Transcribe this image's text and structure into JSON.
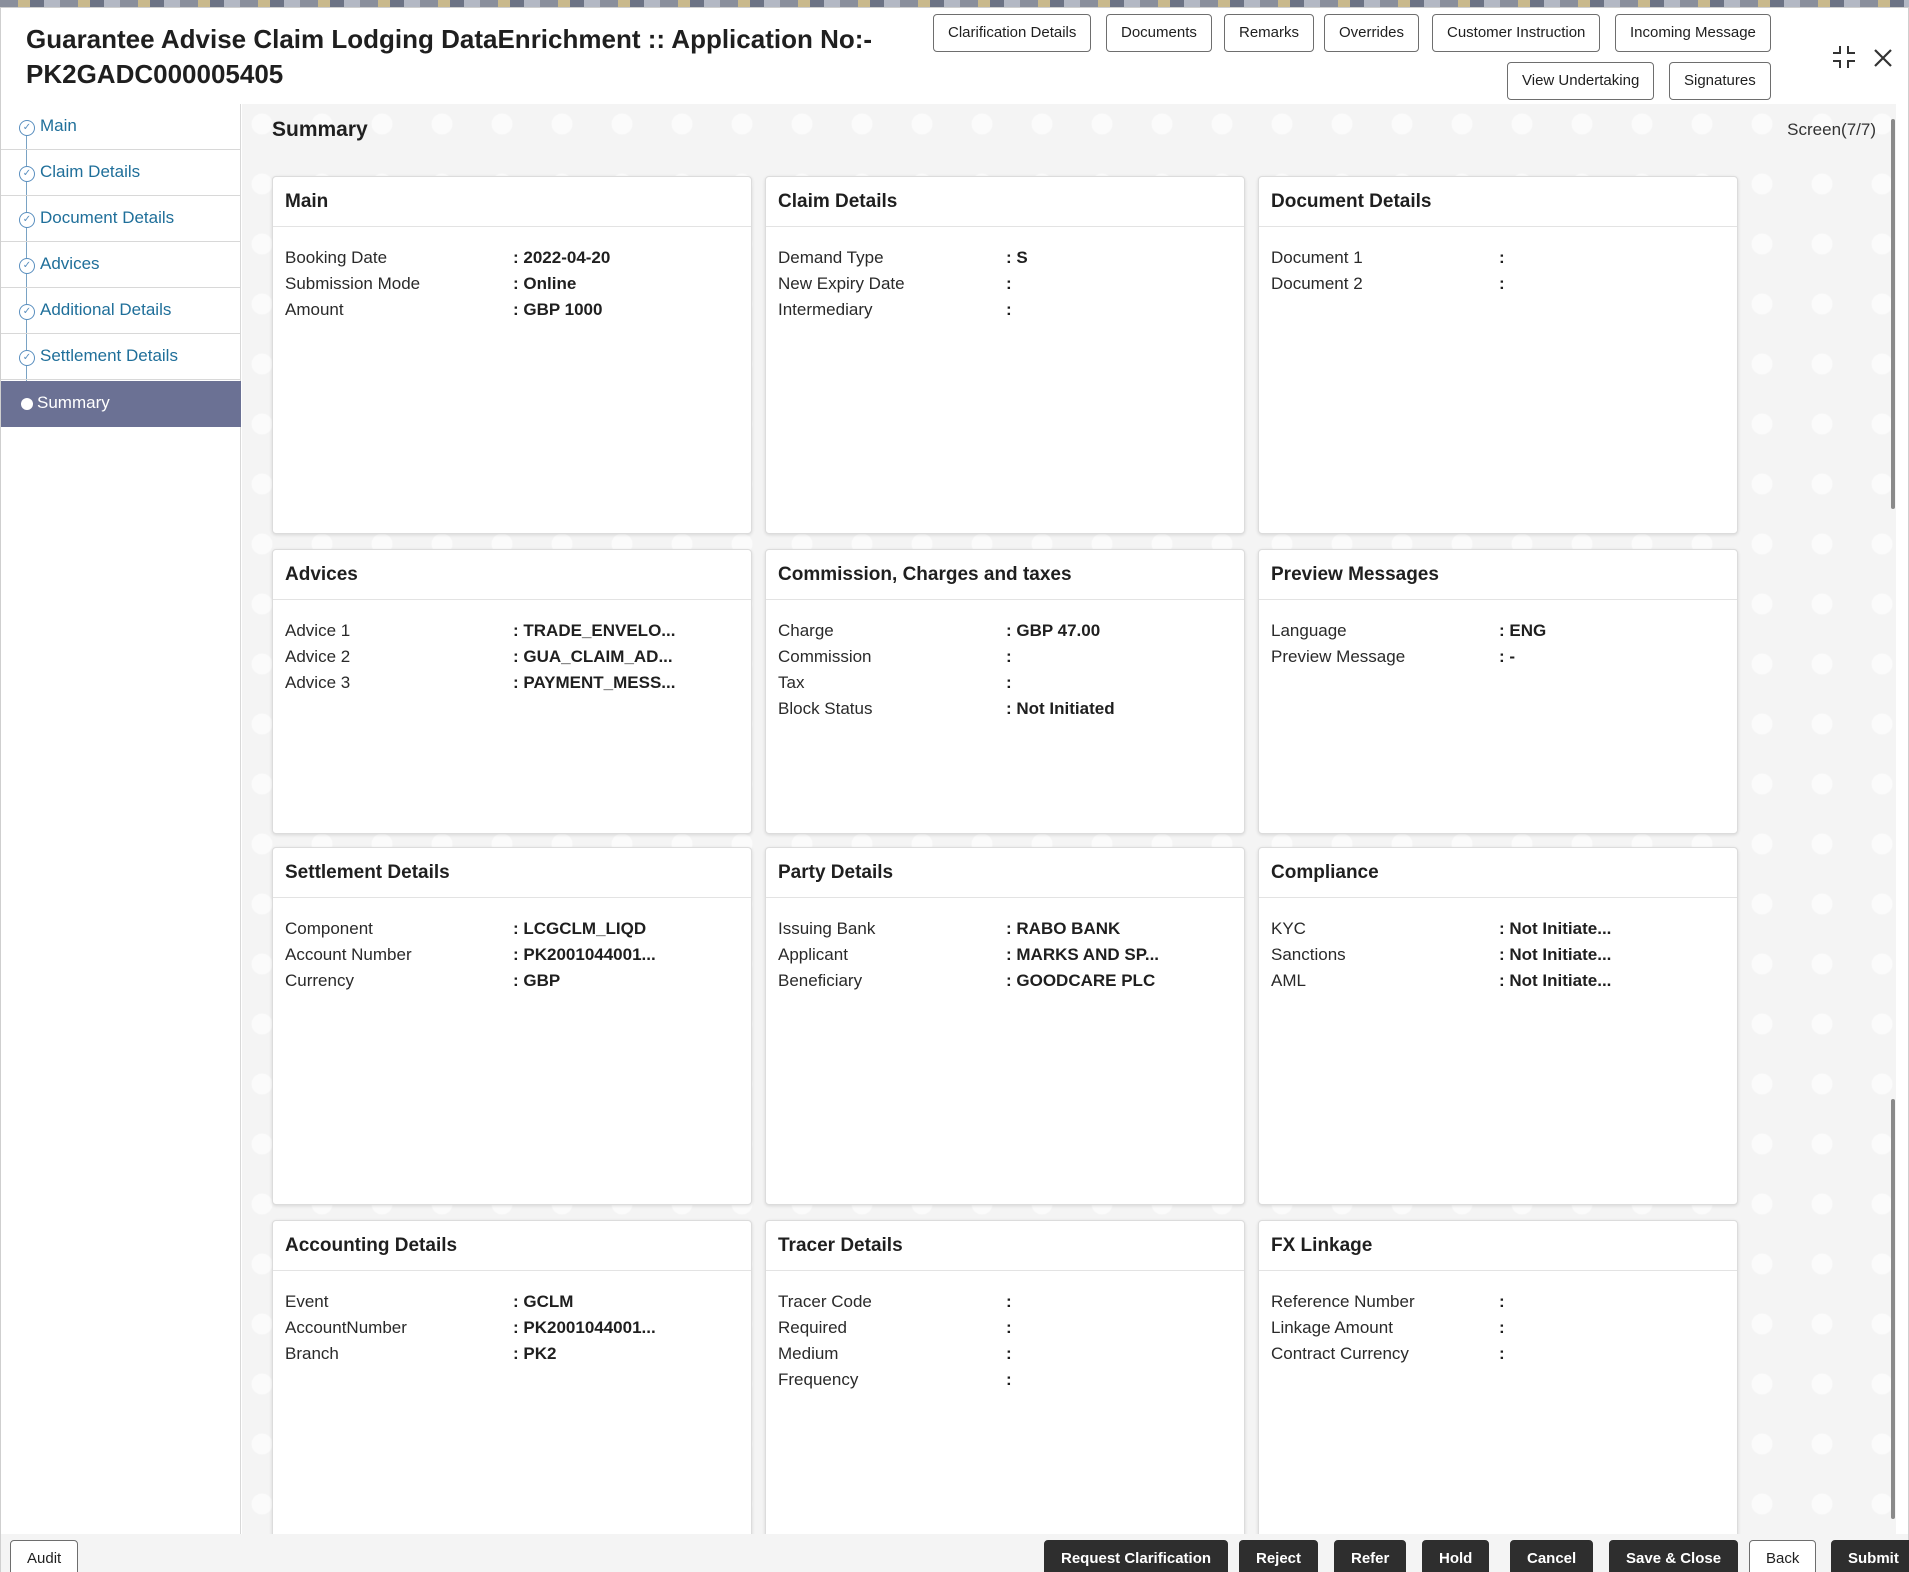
{
  "header": {
    "title_line1": "Guarantee Advise Claim Lodging DataEnrichment :: Application No:-",
    "title_line2": "PK2GADC000005405",
    "buttons": {
      "clarification": "Clarification Details",
      "documents": "Documents",
      "remarks": "Remarks",
      "overrides": "Overrides",
      "customer_instruction": "Customer Instruction",
      "incoming_message": "Incoming Message",
      "view_undertaking": "View Undertaking",
      "signatures": "Signatures"
    },
    "icons": {
      "collapse": "collapse-icon",
      "close": "close-icon"
    }
  },
  "sidebar": {
    "items": [
      {
        "label": "Main"
      },
      {
        "label": "Claim Details"
      },
      {
        "label": "Document Details"
      },
      {
        "label": "Advices"
      },
      {
        "label": "Additional Details"
      },
      {
        "label": "Settlement Details"
      },
      {
        "label": "Summary"
      }
    ]
  },
  "main": {
    "title": "Summary",
    "screen_indicator": "Screen(7/7)",
    "cards": {
      "main": {
        "title": "Main",
        "rows": [
          {
            "label": "Booking Date",
            "value": ": 2022-04-20"
          },
          {
            "label": "Submission Mode",
            "value": ": Online"
          },
          {
            "label": "Amount",
            "value": ": GBP 1000"
          }
        ]
      },
      "claim": {
        "title": "Claim Details",
        "rows": [
          {
            "label": "Demand Type",
            "value": ": S"
          },
          {
            "label": "New Expiry Date",
            "value": ":"
          },
          {
            "label": "Intermediary",
            "value": ":"
          }
        ]
      },
      "document": {
        "title": "Document Details",
        "rows": [
          {
            "label": "Document 1",
            "value": ":"
          },
          {
            "label": "Document 2",
            "value": ":"
          }
        ]
      },
      "advices": {
        "title": "Advices",
        "rows": [
          {
            "label": "Advice 1",
            "value": ": TRADE_ENVELO..."
          },
          {
            "label": "Advice 2",
            "value": ": GUA_CLAIM_AD..."
          },
          {
            "label": "Advice 3",
            "value": ": PAYMENT_MESS..."
          }
        ]
      },
      "commission": {
        "title": "Commission, Charges and taxes",
        "rows": [
          {
            "label": "Charge",
            "value": ": GBP  47.00"
          },
          {
            "label": "Commission",
            "value": ":"
          },
          {
            "label": "Tax",
            "value": ":"
          },
          {
            "label": "Block Status",
            "value": ": Not Initiated"
          }
        ]
      },
      "preview": {
        "title": "Preview Messages",
        "rows": [
          {
            "label": "Language",
            "value": ": ENG"
          },
          {
            "label": "Preview Message",
            "value": ": -"
          }
        ]
      },
      "settlement": {
        "title": "Settlement Details",
        "rows": [
          {
            "label": "Component",
            "value": ": LCGCLM_LIQD"
          },
          {
            "label": "Account Number",
            "value": ": PK2001044001..."
          },
          {
            "label": "Currency",
            "value": ": GBP"
          }
        ]
      },
      "party": {
        "title": "Party Details",
        "rows": [
          {
            "label": "Issuing Bank",
            "value": ": RABO BANK"
          },
          {
            "label": "Applicant",
            "value": ": MARKS AND SP..."
          },
          {
            "label": "Beneficiary",
            "value": ": GOODCARE PLC"
          }
        ]
      },
      "compliance": {
        "title": "Compliance",
        "rows": [
          {
            "label": "KYC",
            "value": ": Not Initiate..."
          },
          {
            "label": "Sanctions",
            "value": ": Not Initiate..."
          },
          {
            "label": "AML",
            "value": ": Not Initiate..."
          }
        ]
      },
      "accounting": {
        "title": "Accounting Details",
        "rows": [
          {
            "label": "Event",
            "value": ": GCLM"
          },
          {
            "label": "AccountNumber",
            "value": ": PK2001044001..."
          },
          {
            "label": "Branch",
            "value": ": PK2"
          }
        ]
      },
      "tracer": {
        "title": "Tracer Details",
        "rows": [
          {
            "label": "Tracer Code",
            "value": ":"
          },
          {
            "label": "Required",
            "value": ":"
          },
          {
            "label": "Medium",
            "value": ":"
          },
          {
            "label": "Frequency",
            "value": ":"
          }
        ]
      },
      "fx": {
        "title": "FX Linkage",
        "rows": [
          {
            "label": "Reference Number",
            "value": ":"
          },
          {
            "label": "Linkage Amount",
            "value": ":"
          },
          {
            "label": "Contract Currency",
            "value": ":"
          }
        ]
      }
    }
  },
  "footer": {
    "audit": "Audit",
    "request_clarification": "Request Clarification",
    "reject": "Reject",
    "refer": "Refer",
    "hold": "Hold",
    "cancel": "Cancel",
    "save_close": "Save & Close",
    "back": "Back",
    "submit": "Submit"
  }
}
